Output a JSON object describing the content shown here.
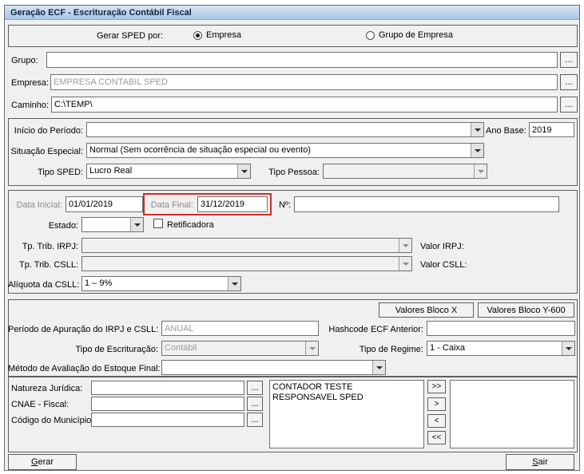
{
  "window": {
    "title": "Geração ECF - Escrituração Contábil Fiscal"
  },
  "colors": {
    "titlebar": "#b9d3ea",
    "highlight_red": "#d22a2a"
  },
  "sped": {
    "label": "Gerar SPED por:",
    "option_empresa": "Empresa",
    "option_grupo": "Grupo de Empresa"
  },
  "grupo": {
    "label": "Grupo:",
    "value": "",
    "browse": "..."
  },
  "empresa": {
    "label": "Empresa:",
    "value": "EMPRESA CONTABIL SPED",
    "browse": "..."
  },
  "caminho": {
    "label": "Caminho:",
    "value": "C:\\TEMP\\",
    "browse": "..."
  },
  "periodo": {
    "inicio_label": "Início do Período:",
    "inicio_value": "",
    "ano_base_label": "Ano Base:",
    "ano_base_value": "2019",
    "situacao_label": "Situação Especial:",
    "situacao_value": "Normal (Sem ocorrência de situação especial ou evento)",
    "tipo_sped_label": "Tipo SPED:",
    "tipo_sped_value": "Lucro Real",
    "tipo_pessoa_label": "Tipo Pessoa:",
    "tipo_pessoa_value": ""
  },
  "datas": {
    "data_inicial_label": "Data Inicial:",
    "data_inicial_value": "01/01/2019",
    "data_final_label": "Data Final:",
    "data_final_value": "31/12/2019",
    "numero_label": "Nº:",
    "numero_value": "",
    "estado_label": "Estado:",
    "estado_value": "",
    "retificadora_label": "Retificadora",
    "retificadora_checked": false,
    "tp_trib_irpj_label": "Tp. Trib. IRPJ:",
    "tp_trib_irpj_value": "",
    "valor_irpj_label": "Valor IRPJ:",
    "tp_trib_csll_label": "Tp. Trib. CSLL:",
    "tp_trib_csll_value": "",
    "valor_csll_label": "Valor CSLL:",
    "aliquota_label": "Alíquota da CSLL:",
    "aliquota_value": "1 – 9%"
  },
  "apuracao": {
    "valores_bloco_x": "Valores Bloco X",
    "valores_bloco_y": "Valores Bloco Y-600",
    "periodo_label": "Período de Apuração do IRPJ e CSLL:",
    "periodo_value": "ANUAL",
    "hashcode_label": "Hashcode ECF Anterior:",
    "hashcode_value": "",
    "tipo_escrituracao_label": "Tipo de Escrituração:",
    "tipo_escrituracao_value": "Contábil",
    "tipo_regime_label": "Tipo de Regime:",
    "tipo_regime_value": "1 - Caixa",
    "metodo_label": "Método de Avaliação do Estoque Final:",
    "metodo_value": ""
  },
  "cadastro": {
    "natureza_label": "Natureza Jurídica:",
    "natureza_value": "",
    "cnae_label": "CNAE - Fiscal:",
    "cnae_value": "",
    "municipio_label": "Código do Município:",
    "municipio_value": "",
    "browse": "...",
    "lista_selecionados": [
      "CONTADOR TESTE",
      "RESPONSAVEL SPED"
    ],
    "transfer": [
      ">>",
      ">",
      "<",
      "<<"
    ]
  },
  "footer": {
    "gerar": "Gerar",
    "sair": "Sair"
  }
}
